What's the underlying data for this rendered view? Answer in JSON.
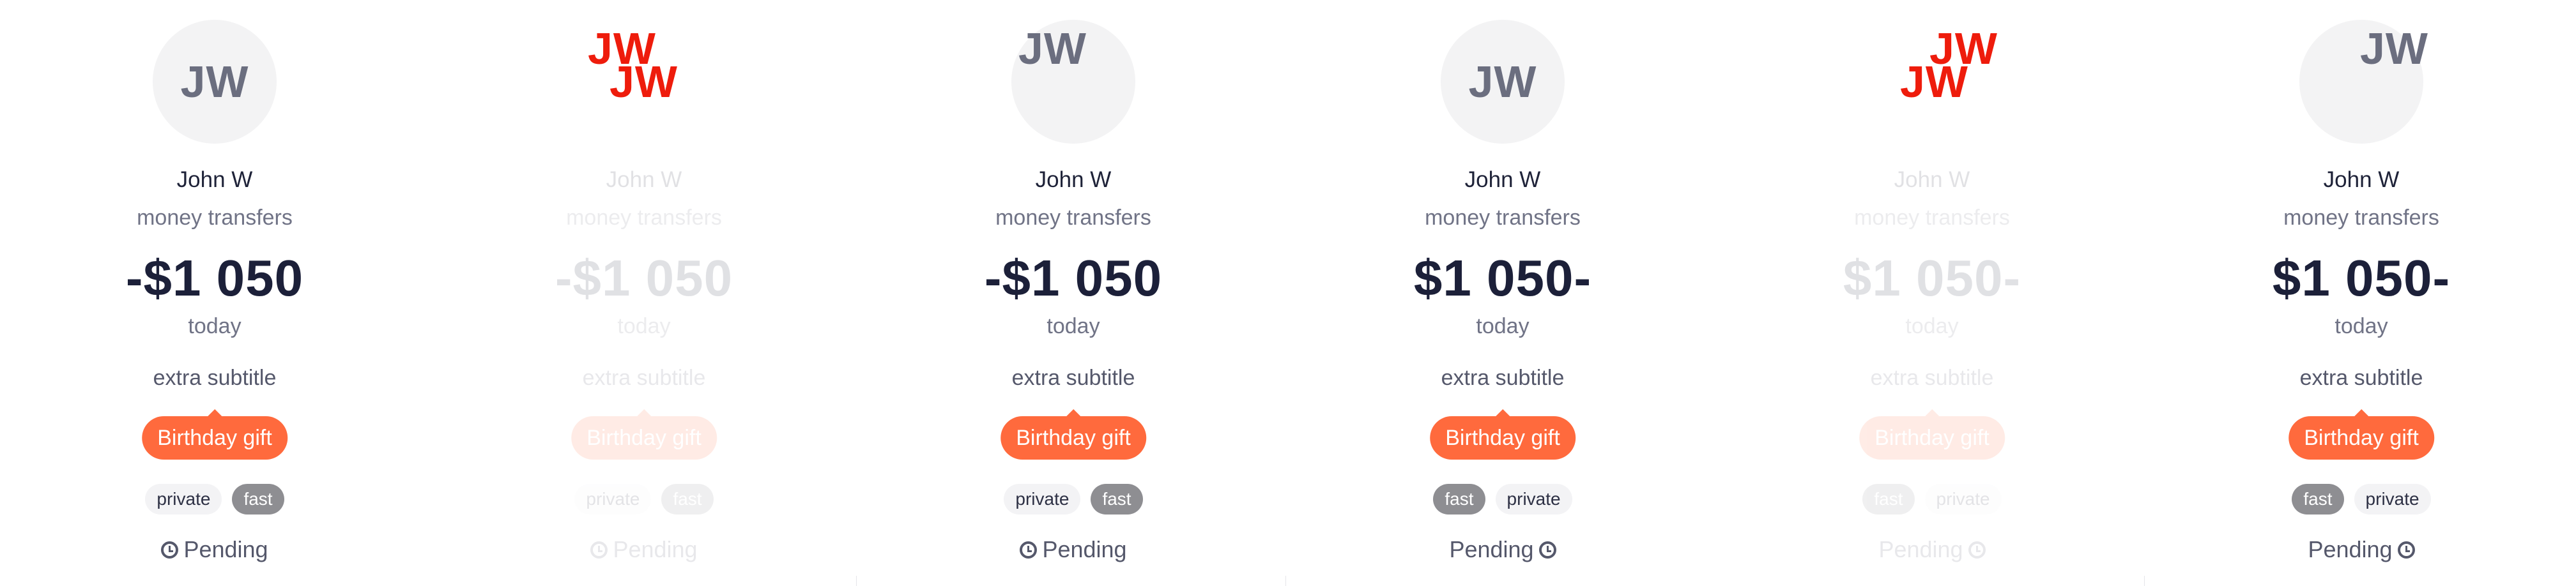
{
  "initials": "JW",
  "name": "John W",
  "subtitle": "money transfers",
  "amount_minus_prefix": "-$1 050",
  "amount_minus_suffix": "$1 050-",
  "date": "today",
  "extra_subtitle": "extra subtitle",
  "tag": "Birthday gift",
  "chip_private": "private",
  "chip_fast": "fast",
  "status": "Pending",
  "colors": {
    "accent": "#ff6a3d",
    "initials_red": "#ee1c0c",
    "amount": "#1c2039",
    "chip_dark": "#8e8e92"
  },
  "icons": {
    "status": "clock-icon"
  }
}
